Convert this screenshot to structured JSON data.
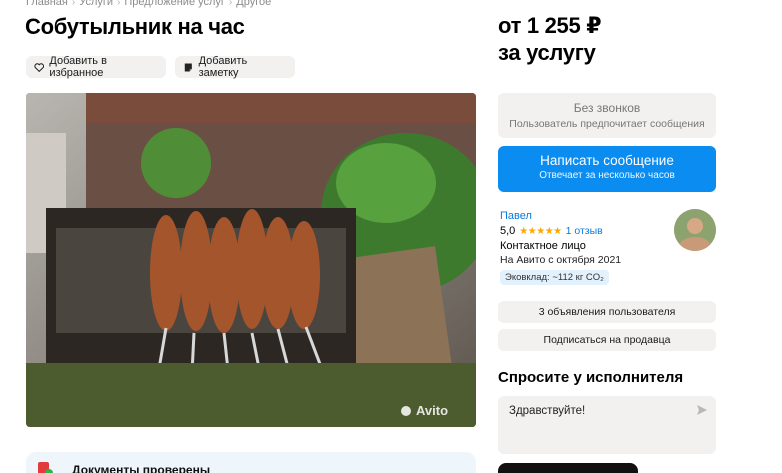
{
  "breadcrumb": [
    "Главная",
    "Услуги",
    "Предложение услуг",
    "Другое"
  ],
  "title": "Собутыльник на час",
  "actions": {
    "favorite": "Добавить в избранное",
    "note": "Добавить заметку"
  },
  "photo": {
    "watermark": "Avito",
    "alt_subject": "shashlik-grill"
  },
  "documents_banner": "Документы проверены",
  "price": {
    "line1": "от 1 255 ₽",
    "line2": "за услугу"
  },
  "no_calls": {
    "title": "Без звонков",
    "subtitle": "Пользователь предпочитает сообщения"
  },
  "write_button": {
    "title": "Написать сообщение",
    "subtitle": "Отвечает за несколько часов"
  },
  "seller": {
    "name": "Павел",
    "rating": "5,0",
    "stars": "★★★★★",
    "rating_value": 5,
    "reviews": "1 отзыв",
    "role": "Контактное лицо",
    "since": "На Авито с октября 2021",
    "eco": "Эковклад: ~112 кг CO₂"
  },
  "buttons": {
    "user_ads": "3 объявления пользователя",
    "subscribe": "Подписаться на продавца"
  },
  "ask": {
    "title": "Спросите у исполнителя",
    "message": "Здравствуйте!"
  },
  "colors": {
    "accent": "#0a8cf0",
    "link": "#0a7ad9",
    "star": "#ffa800",
    "gray_bg": "#f2f1f0"
  },
  "icons": {
    "favorite": "heart-icon",
    "note": "note-icon",
    "send": "send-icon",
    "documents": "document-check-icon"
  }
}
